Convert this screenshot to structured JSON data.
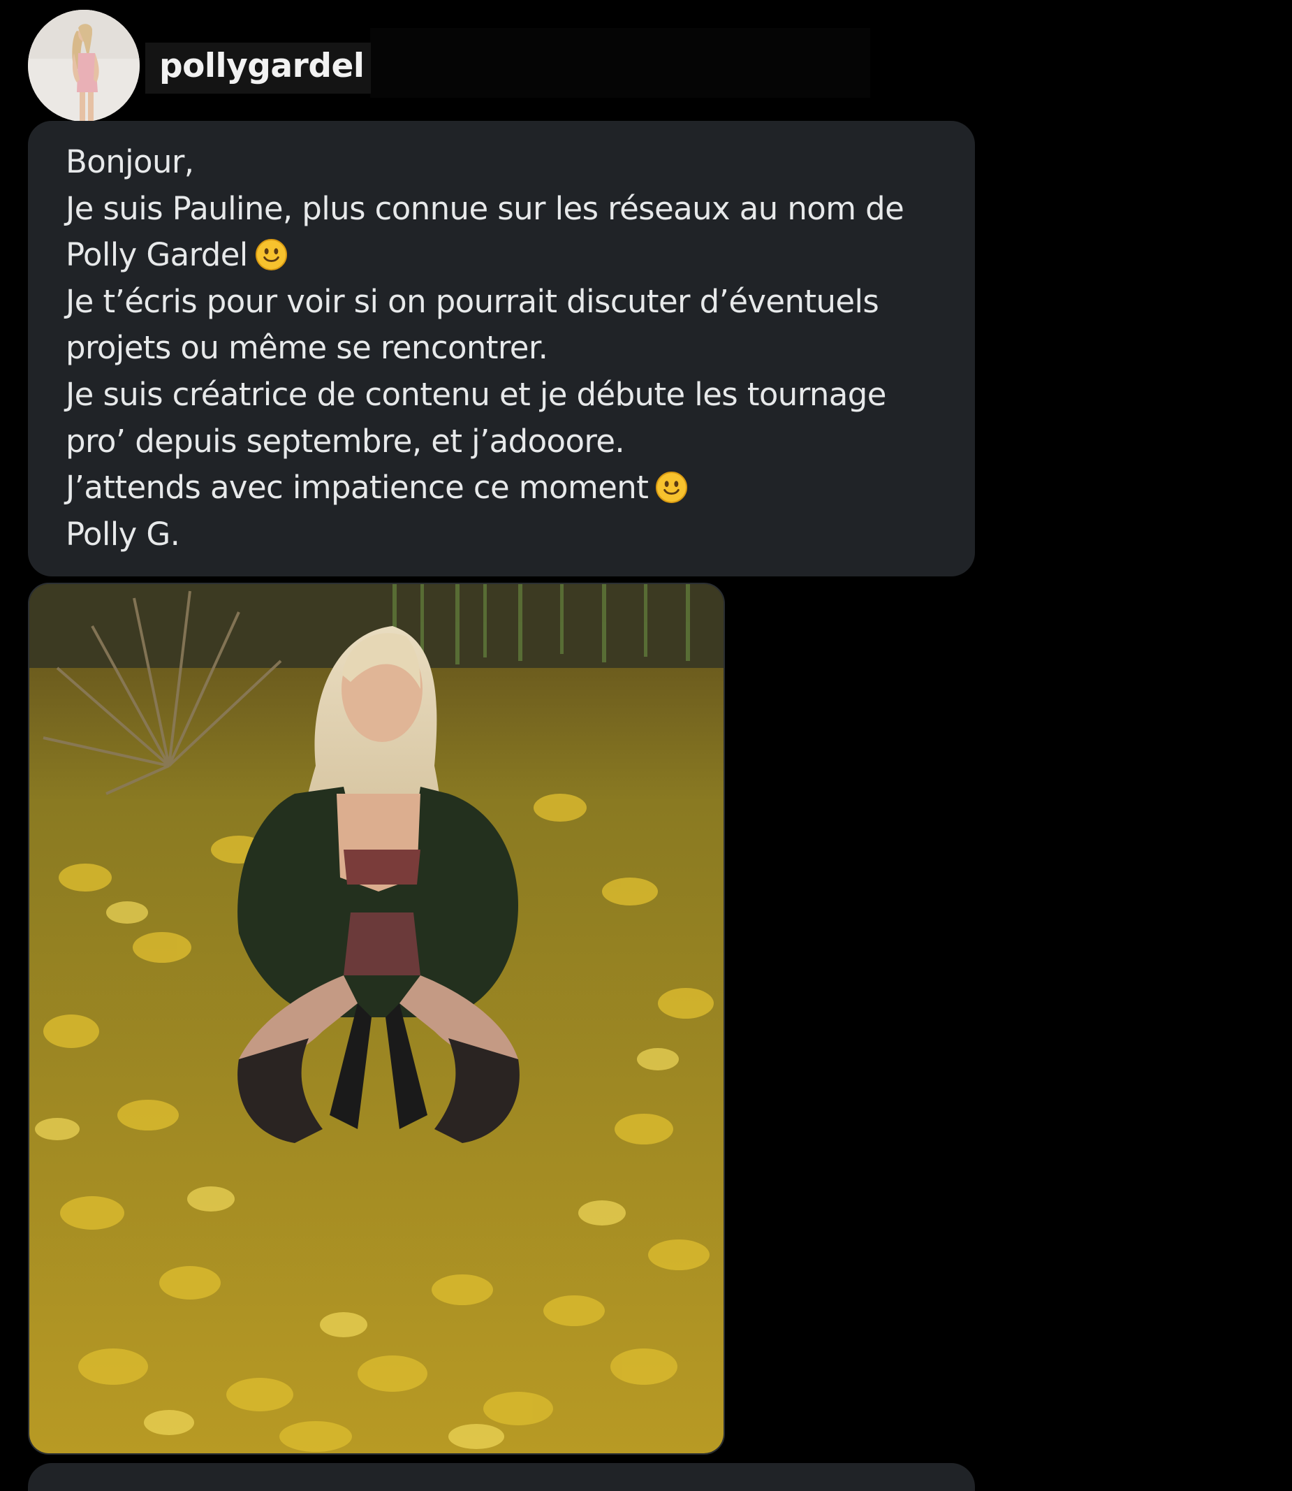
{
  "sender": {
    "username": "pollygardel",
    "avatar_icon": "profile-photo-avatar"
  },
  "message": {
    "lines": [
      {
        "text": "Bonjour,",
        "emoji": false
      },
      {
        "text": "Je suis Pauline, plus connue sur les réseaux au nom de",
        "emoji": false
      },
      {
        "text": "Polly Gardel",
        "emoji": true
      },
      {
        "text": "Je t’écris pour voir si on pourrait discuter d’éventuels",
        "emoji": false
      },
      {
        "text": "projets ou même se rencontrer.",
        "emoji": false
      },
      {
        "text": "Je suis créatrice de contenu et je débute les tournage",
        "emoji": false
      },
      {
        "text": "pro’ depuis septembre, et j’adooore.",
        "emoji": false
      },
      {
        "text": "J’attends avec impatience ce moment",
        "emoji": true
      },
      {
        "text": "Polly G.",
        "emoji": false
      }
    ],
    "emoji_icon": "slightly-smiling-face-icon"
  },
  "attachment": {
    "type": "photo",
    "icon": "image-attachment"
  },
  "colors": {
    "background": "#000000",
    "bubble": "#202327",
    "text": "#e7e9ea",
    "emoji_face": "#f7c22e"
  }
}
